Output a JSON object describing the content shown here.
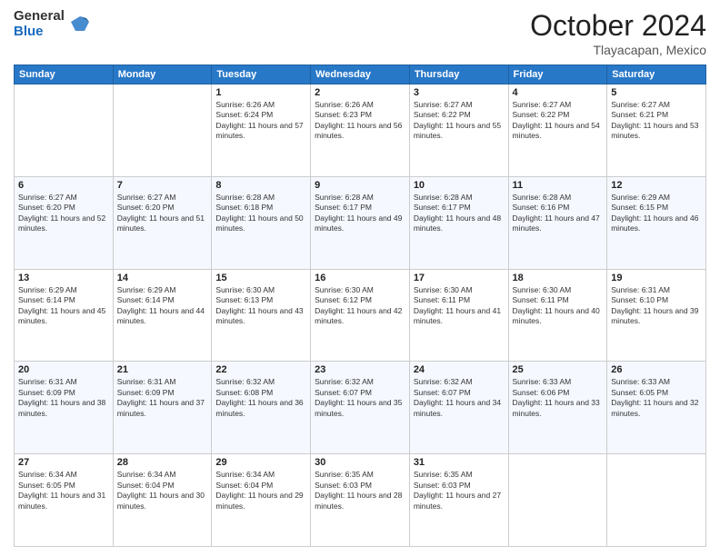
{
  "logo": {
    "general": "General",
    "blue": "Blue"
  },
  "title": "October 2024",
  "location": "Tlayacapan, Mexico",
  "days": [
    "Sunday",
    "Monday",
    "Tuesday",
    "Wednesday",
    "Thursday",
    "Friday",
    "Saturday"
  ],
  "weeks": [
    [
      {
        "day": "",
        "content": ""
      },
      {
        "day": "",
        "content": ""
      },
      {
        "day": "1",
        "content": "Sunrise: 6:26 AM\nSunset: 6:24 PM\nDaylight: 11 hours and 57 minutes."
      },
      {
        "day": "2",
        "content": "Sunrise: 6:26 AM\nSunset: 6:23 PM\nDaylight: 11 hours and 56 minutes."
      },
      {
        "day": "3",
        "content": "Sunrise: 6:27 AM\nSunset: 6:22 PM\nDaylight: 11 hours and 55 minutes."
      },
      {
        "day": "4",
        "content": "Sunrise: 6:27 AM\nSunset: 6:22 PM\nDaylight: 11 hours and 54 minutes."
      },
      {
        "day": "5",
        "content": "Sunrise: 6:27 AM\nSunset: 6:21 PM\nDaylight: 11 hours and 53 minutes."
      }
    ],
    [
      {
        "day": "6",
        "content": "Sunrise: 6:27 AM\nSunset: 6:20 PM\nDaylight: 11 hours and 52 minutes."
      },
      {
        "day": "7",
        "content": "Sunrise: 6:27 AM\nSunset: 6:20 PM\nDaylight: 11 hours and 51 minutes."
      },
      {
        "day": "8",
        "content": "Sunrise: 6:28 AM\nSunset: 6:18 PM\nDaylight: 11 hours and 50 minutes."
      },
      {
        "day": "9",
        "content": "Sunrise: 6:28 AM\nSunset: 6:17 PM\nDaylight: 11 hours and 49 minutes."
      },
      {
        "day": "10",
        "content": "Sunrise: 6:28 AM\nSunset: 6:17 PM\nDaylight: 11 hours and 48 minutes."
      },
      {
        "day": "11",
        "content": "Sunrise: 6:28 AM\nSunset: 6:16 PM\nDaylight: 11 hours and 47 minutes."
      },
      {
        "day": "12",
        "content": "Sunrise: 6:29 AM\nSunset: 6:15 PM\nDaylight: 11 hours and 46 minutes."
      }
    ],
    [
      {
        "day": "13",
        "content": "Sunrise: 6:29 AM\nSunset: 6:14 PM\nDaylight: 11 hours and 45 minutes."
      },
      {
        "day": "14",
        "content": "Sunrise: 6:29 AM\nSunset: 6:14 PM\nDaylight: 11 hours and 44 minutes."
      },
      {
        "day": "15",
        "content": "Sunrise: 6:30 AM\nSunset: 6:13 PM\nDaylight: 11 hours and 43 minutes."
      },
      {
        "day": "16",
        "content": "Sunrise: 6:30 AM\nSunset: 6:12 PM\nDaylight: 11 hours and 42 minutes."
      },
      {
        "day": "17",
        "content": "Sunrise: 6:30 AM\nSunset: 6:11 PM\nDaylight: 11 hours and 41 minutes."
      },
      {
        "day": "18",
        "content": "Sunrise: 6:30 AM\nSunset: 6:11 PM\nDaylight: 11 hours and 40 minutes."
      },
      {
        "day": "19",
        "content": "Sunrise: 6:31 AM\nSunset: 6:10 PM\nDaylight: 11 hours and 39 minutes."
      }
    ],
    [
      {
        "day": "20",
        "content": "Sunrise: 6:31 AM\nSunset: 6:09 PM\nDaylight: 11 hours and 38 minutes."
      },
      {
        "day": "21",
        "content": "Sunrise: 6:31 AM\nSunset: 6:09 PM\nDaylight: 11 hours and 37 minutes."
      },
      {
        "day": "22",
        "content": "Sunrise: 6:32 AM\nSunset: 6:08 PM\nDaylight: 11 hours and 36 minutes."
      },
      {
        "day": "23",
        "content": "Sunrise: 6:32 AM\nSunset: 6:07 PM\nDaylight: 11 hours and 35 minutes."
      },
      {
        "day": "24",
        "content": "Sunrise: 6:32 AM\nSunset: 6:07 PM\nDaylight: 11 hours and 34 minutes."
      },
      {
        "day": "25",
        "content": "Sunrise: 6:33 AM\nSunset: 6:06 PM\nDaylight: 11 hours and 33 minutes."
      },
      {
        "day": "26",
        "content": "Sunrise: 6:33 AM\nSunset: 6:05 PM\nDaylight: 11 hours and 32 minutes."
      }
    ],
    [
      {
        "day": "27",
        "content": "Sunrise: 6:34 AM\nSunset: 6:05 PM\nDaylight: 11 hours and 31 minutes."
      },
      {
        "day": "28",
        "content": "Sunrise: 6:34 AM\nSunset: 6:04 PM\nDaylight: 11 hours and 30 minutes."
      },
      {
        "day": "29",
        "content": "Sunrise: 6:34 AM\nSunset: 6:04 PM\nDaylight: 11 hours and 29 minutes."
      },
      {
        "day": "30",
        "content": "Sunrise: 6:35 AM\nSunset: 6:03 PM\nDaylight: 11 hours and 28 minutes."
      },
      {
        "day": "31",
        "content": "Sunrise: 6:35 AM\nSunset: 6:03 PM\nDaylight: 11 hours and 27 minutes."
      },
      {
        "day": "",
        "content": ""
      },
      {
        "day": "",
        "content": ""
      }
    ]
  ]
}
